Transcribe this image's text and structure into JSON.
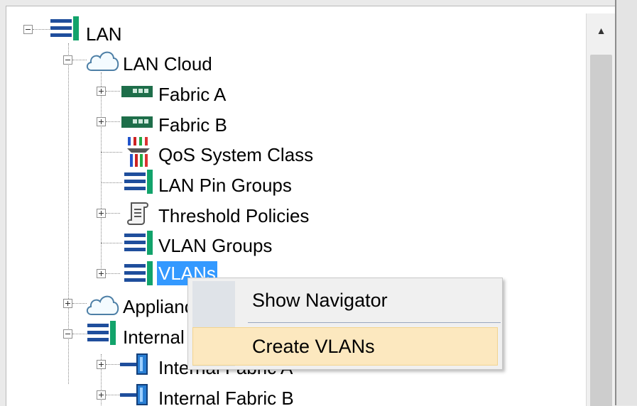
{
  "tree": {
    "items": [
      {
        "label": "LAN"
      },
      {
        "label": "LAN Cloud"
      },
      {
        "label": "Fabric A"
      },
      {
        "label": "Fabric B"
      },
      {
        "label": "QoS System Class"
      },
      {
        "label": "LAN Pin Groups"
      },
      {
        "label": "Threshold Policies"
      },
      {
        "label": "VLAN Groups"
      },
      {
        "label": "VLANs"
      },
      {
        "label": "Appliances"
      },
      {
        "label": "Internal LAN"
      },
      {
        "label": "Internal Fabric A"
      },
      {
        "label": "Internal Fabric B"
      }
    ]
  },
  "context_menu": {
    "items": [
      {
        "label": "Show Navigator"
      },
      {
        "label": "Create VLANs"
      }
    ]
  },
  "colors": {
    "selection": "#3399ff",
    "menu_hover": "#fce8bf",
    "lan_icon_blue": "#1f4e9c",
    "lan_icon_green": "#12a36b"
  },
  "icons": {
    "lan": "lan-icon",
    "cloud": "cloud-icon",
    "fabric": "fabric-interconnect-icon",
    "qos": "qos-icon",
    "threshold": "scroll-icon",
    "internal_fabric": "internal-fabric-icon"
  }
}
